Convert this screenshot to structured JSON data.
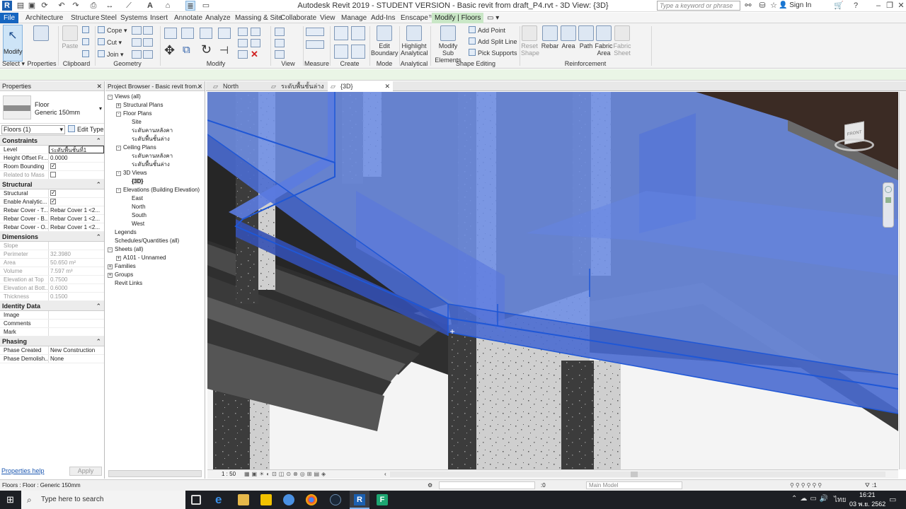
{
  "window": {
    "title": "Autodesk Revit 2019 - STUDENT VERSION - Basic revit from draft_P4.rvt - 3D View: {3D}",
    "search_placeholder": "Type a keyword or phrase",
    "sign_in": "Sign In"
  },
  "menu": [
    "File",
    "Architecture",
    "Structure",
    "Steel",
    "Systems",
    "Insert",
    "Annotate",
    "Analyze",
    "Massing & Site",
    "Collaborate",
    "View",
    "Manage",
    "Add-Ins",
    "Enscape™",
    "Modify | Floors"
  ],
  "ribbon": {
    "modify": "Modify",
    "properties": "Properties",
    "paste": "Paste",
    "cope": "Cope",
    "cut": "Cut",
    "join": "Join",
    "edit_boundary": [
      "Edit",
      "Boundary"
    ],
    "highlight_analytical": [
      "Highlight",
      "Analytical"
    ],
    "modify_sub": [
      "Modify",
      "Sub Elements"
    ],
    "add_point": "Add Point",
    "add_split_line": "Add Split Line",
    "pick_supports": "Pick Supports",
    "reset_shape": [
      "Reset",
      "Shape"
    ],
    "rebar": "Rebar",
    "area": "Area",
    "path": "Path",
    "fabric_area": [
      "Fabric",
      "Area"
    ],
    "fabric_sheet": [
      "Fabric",
      "Sheet"
    ],
    "groups": {
      "select": "Select",
      "properties": "Properties",
      "clipboard": "Clipboard",
      "geometry": "Geometry",
      "modify": "Modify",
      "view": "View",
      "measure": "Measure",
      "create": "Create",
      "mode": "Mode",
      "analytical": "Analytical",
      "shape_editing": "Shape Editing",
      "reinforcement": "Reinforcement"
    }
  },
  "properties": {
    "header": "Properties",
    "family": "Floor",
    "type": "Generic 150mm",
    "selector": "Floors (1)",
    "edit_type": "Edit Type",
    "sections": [
      {
        "name": "Constraints",
        "rows": [
          {
            "k": "Level",
            "v": "ระดับพื้นชั้นที่1"
          },
          {
            "k": "Height Offset Fr...",
            "v": "0.0000"
          },
          {
            "k": "Room Bounding",
            "v": "",
            "check": true
          },
          {
            "k": "Related to Mass",
            "v": "",
            "check": false,
            "ro": true
          }
        ]
      },
      {
        "name": "Structural",
        "rows": [
          {
            "k": "Structural",
            "v": "",
            "check": true
          },
          {
            "k": "Enable Analytic...",
            "v": "",
            "check": true
          },
          {
            "k": "Rebar Cover - T...",
            "v": "Rebar Cover 1 <2..."
          },
          {
            "k": "Rebar Cover - B...",
            "v": "Rebar Cover 1 <2..."
          },
          {
            "k": "Rebar Cover - O...",
            "v": "Rebar Cover 1 <2..."
          }
        ]
      },
      {
        "name": "Dimensions",
        "rows": [
          {
            "k": "Slope",
            "v": "",
            "ro": true
          },
          {
            "k": "Perimeter",
            "v": "32.3980",
            "ro": true
          },
          {
            "k": "Area",
            "v": "50.650 m²",
            "ro": true
          },
          {
            "k": "Volume",
            "v": "7.597 m³",
            "ro": true
          },
          {
            "k": "Elevation at Top",
            "v": "0.7500",
            "ro": true
          },
          {
            "k": "Elevation at Bott...",
            "v": "0.6000",
            "ro": true
          },
          {
            "k": "Thickness",
            "v": "0.1500",
            "ro": true
          }
        ]
      },
      {
        "name": "Identity Data",
        "rows": [
          {
            "k": "Image",
            "v": ""
          },
          {
            "k": "Comments",
            "v": ""
          },
          {
            "k": "Mark",
            "v": ""
          }
        ]
      },
      {
        "name": "Phasing",
        "rows": [
          {
            "k": "Phase Created",
            "v": "New Construction"
          },
          {
            "k": "Phase Demolish...",
            "v": "None"
          }
        ]
      }
    ],
    "help": "Properties help",
    "apply": "Apply"
  },
  "browser": {
    "title": "Project Browser - Basic revit from...",
    "items": [
      {
        "t": "Views (all)",
        "lvl": 0,
        "tog": "-"
      },
      {
        "t": "Structural Plans",
        "lvl": 1,
        "tog": "+"
      },
      {
        "t": "Floor Plans",
        "lvl": 1,
        "tog": "-"
      },
      {
        "t": "Site",
        "lvl": 2
      },
      {
        "t": "ระดับคานหลังคา",
        "lvl": 2
      },
      {
        "t": "ระดับพื้นชั้นล่าง",
        "lvl": 2
      },
      {
        "t": "Ceiling Plans",
        "lvl": 1,
        "tog": "-"
      },
      {
        "t": "ระดับคานหลังคา",
        "lvl": 2
      },
      {
        "t": "ระดับพื้นชั้นล่าง",
        "lvl": 2
      },
      {
        "t": "3D Views",
        "lvl": 1,
        "tog": "-"
      },
      {
        "t": "{3D}",
        "lvl": 2,
        "bold": true
      },
      {
        "t": "Elevations (Building Elevation)",
        "lvl": 1,
        "tog": "-"
      },
      {
        "t": "East",
        "lvl": 2
      },
      {
        "t": "North",
        "lvl": 2
      },
      {
        "t": "South",
        "lvl": 2
      },
      {
        "t": "West",
        "lvl": 2
      },
      {
        "t": "Legends",
        "lvl": 0
      },
      {
        "t": "Schedules/Quantities (all)",
        "lvl": 0
      },
      {
        "t": "Sheets (all)",
        "lvl": 0,
        "tog": "-"
      },
      {
        "t": "A101 - Unnamed",
        "lvl": 1,
        "tog": "+"
      },
      {
        "t": "Families",
        "lvl": 0,
        "tog": "+"
      },
      {
        "t": "Groups",
        "lvl": 0,
        "tog": "+"
      },
      {
        "t": "Revit Links",
        "lvl": 0
      }
    ]
  },
  "tabs": [
    {
      "label": "North"
    },
    {
      "label": "ระดับพื้นชั้นล่าง"
    },
    {
      "label": "{3D}",
      "active": true
    }
  ],
  "viewcube": {
    "label": "FRONT"
  },
  "view_status": {
    "scale": "1 : 50"
  },
  "status": {
    "text": "Floors : Floor : Generic 150mm",
    "worksets": ":0",
    "model": "Main Model",
    "filter": ":1"
  },
  "taskbar": {
    "search": "Type here to search",
    "time": "16:21",
    "date": "03 พ.ย. 2562"
  },
  "colors": {
    "floor": "#6f8fe6",
    "selection": "#1f57d6",
    "file": "#1565c0",
    "context_tab": "#c9e7c6"
  }
}
